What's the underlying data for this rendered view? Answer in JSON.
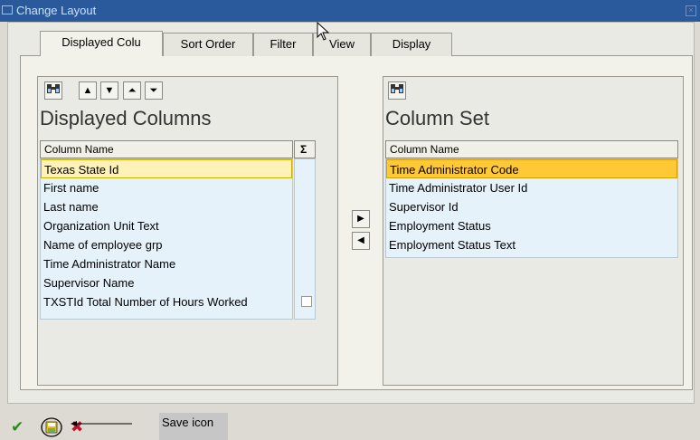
{
  "window": {
    "title": "Change Layout"
  },
  "tabs": [
    {
      "label": "Displayed Colu"
    },
    {
      "label": "Sort Order"
    },
    {
      "label": "Filter"
    },
    {
      "label": "View"
    },
    {
      "label": "Display"
    }
  ],
  "left_panel": {
    "title": "Displayed Columns",
    "column_header": "Column Name",
    "sum_header": "Σ",
    "rows": [
      "Texas State Id",
      "First name",
      "Last name",
      "Organization Unit Text",
      "Name of employee grp",
      "Time Administrator Name",
      "Supervisor Name",
      "TXSTId Total Number of Hours Worked"
    ],
    "selected_row": 0
  },
  "right_panel": {
    "title": "Column Set",
    "column_header": "Column Name",
    "rows": [
      "Time Administrator Code",
      "Time Administrator User Id",
      "Supervisor Id",
      "Employment Status",
      "Employment Status Text"
    ],
    "selected_row": 0
  },
  "annotation": {
    "label": "Save icon"
  },
  "colors": {
    "titlebar": "#2a5a9c",
    "selection_yellow": "#fff2b8",
    "selection_orange": "#ffc835",
    "list_bg": "#e6f2fa"
  }
}
